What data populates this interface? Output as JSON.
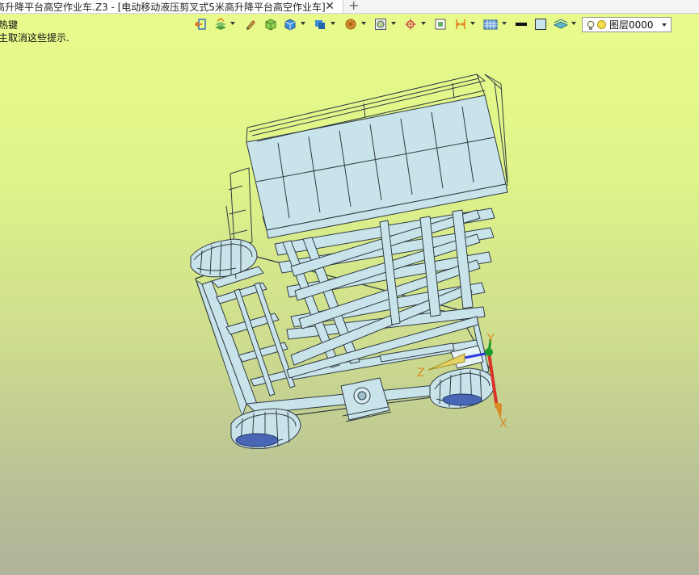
{
  "tab": {
    "title": "高升降平台高空作业车.Z3 - [电动移动液压剪叉式5米高升降平台高空作业车]",
    "close_glyph": "✕",
    "new_tab_glyph": "+"
  },
  "hints": [
    "热键",
    "主取消这些提示."
  ],
  "toolbar": {
    "icons": [
      "exit-icon",
      "layers-stack-icon",
      "pencil-icon",
      "solid-box-icon",
      "box-icon",
      "display-icon",
      "wheel-icon",
      "view-icon",
      "target-icon",
      "frame-icon",
      "dimension-icon",
      "grid-icon",
      "line-color-swatch",
      "fill-color-swatch",
      "layer-plane-icon"
    ]
  },
  "layer_selector": {
    "value": "图层0000",
    "icons": [
      "light-bulb-icon",
      "layer-color-dot"
    ]
  },
  "triad": {
    "x": "X",
    "y": "Y",
    "z": "Z"
  },
  "colors": {
    "background_top": "#e9fb8c",
    "background_bottom": "#b0b49a",
    "model_stroke": "#2f3b44",
    "model_fill": "#c9e3ea",
    "axis_label": "#d98a20"
  }
}
